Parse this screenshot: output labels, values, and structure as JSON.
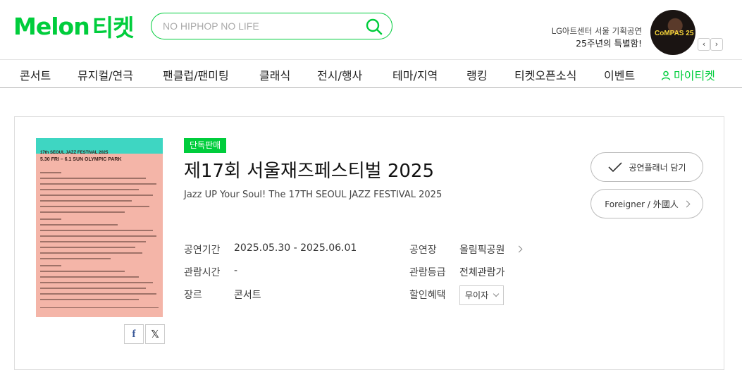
{
  "header": {
    "logo_text": "Melon",
    "logo_suffix": "티켓",
    "search_placeholder": "NO HIPHOP NO LIFE",
    "promo_line1": "LG아트센터 서울 기획공연",
    "promo_line2": "25주년의 특별함!",
    "promo_image_text": "CoMPAS 25",
    "promo_prev": "‹",
    "promo_next": "›"
  },
  "gnb": {
    "items": [
      "콘서트",
      "뮤지컬/연극",
      "팬클럽/팬미팅",
      "클래식",
      "전시/행사",
      "테마/지역",
      "랭킹",
      "티켓오픈소식",
      "이벤트"
    ],
    "my_ticket": "마이티켓"
  },
  "poster": {
    "title_line1": "17th SEOUL JAZZ FESTIVAL 2025",
    "title_line2": "5.30 FRI – 6.1 SUN  OLYMPIC PARK"
  },
  "share": {
    "facebook": "f",
    "x": "𝕏"
  },
  "product": {
    "badge": "단독판매",
    "title": "제17회 서울재즈페스티벌 2025",
    "subtitle": "Jazz UP Your Soul! The 17TH SEOUL JAZZ FESTIVAL 2025",
    "planner_button": "공연플래너 담기",
    "foreigner_button": "Foreigner / 外國人",
    "period_label": "공연기간",
    "period_value": "2025.05.30 - 2025.06.01",
    "runtime_label": "관람시간",
    "runtime_value": "-",
    "genre_label": "장르",
    "genre_value": "콘서트",
    "venue_label": "공연장",
    "venue_value": "올림픽공원",
    "rating_label": "관람등급",
    "rating_value": "전체관람가",
    "discount_label": "할인혜택",
    "discount_value": "무이자"
  },
  "colors": {
    "brand": "#00cd3c"
  }
}
